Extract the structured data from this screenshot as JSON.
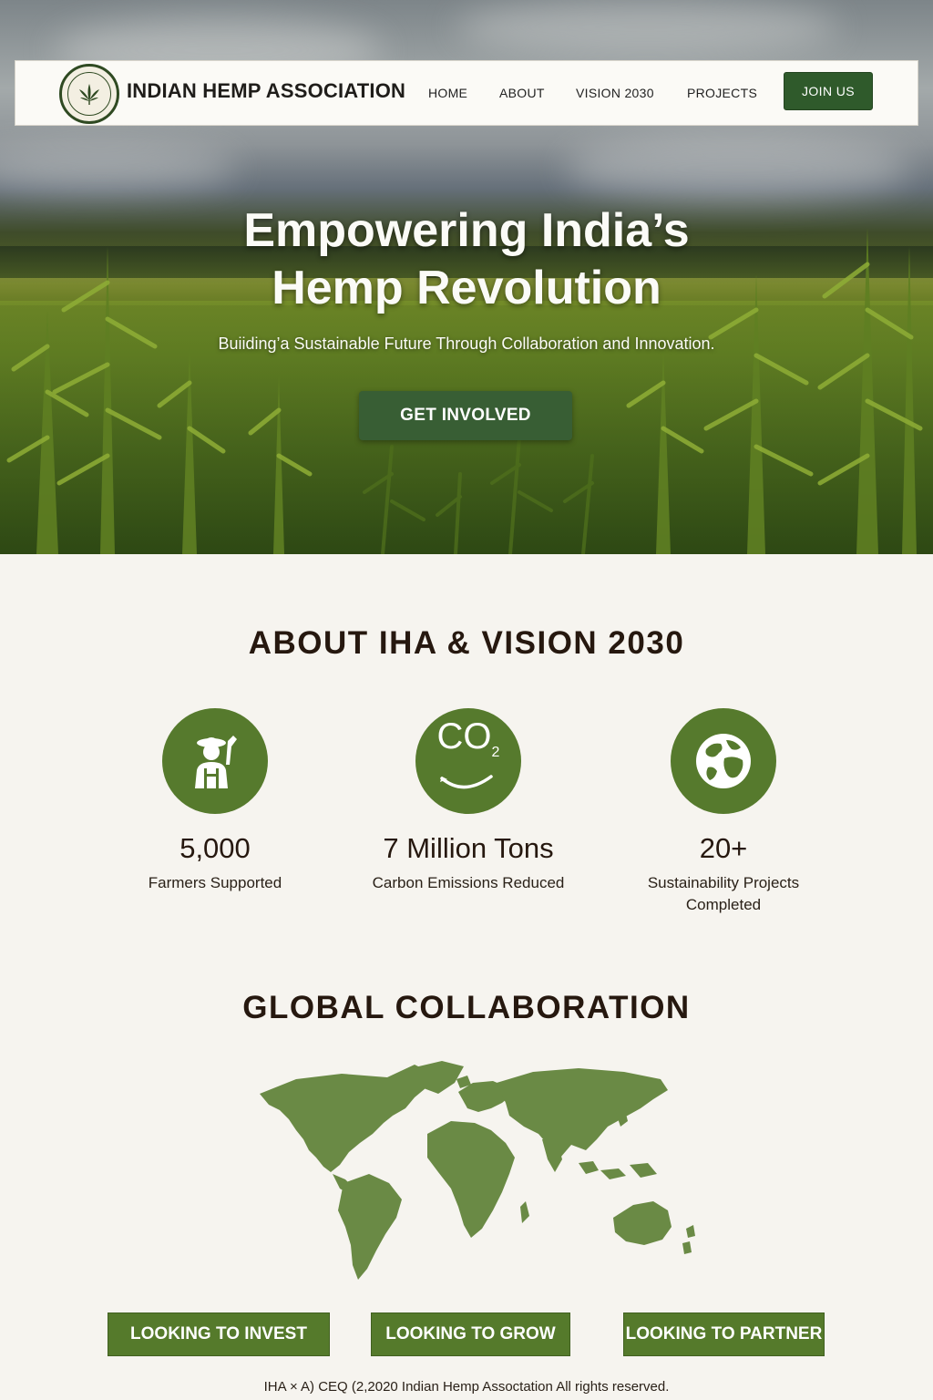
{
  "brand": {
    "name": "INDIAN HEMP ASSOCIATION",
    "logo_icon": "hemp-leaf-seal-icon",
    "accent_color": "#2f5a2b"
  },
  "nav": {
    "items": [
      {
        "label": "HOME"
      },
      {
        "label": "ABOUT"
      },
      {
        "label": "VISION 2030"
      },
      {
        "label": "PROJECTS"
      }
    ],
    "join_label": "JOIN US"
  },
  "hero": {
    "title_line1": "Empowering India’s",
    "title_line2": "Hemp Revolution",
    "subtitle": "Buiiding’a Sustainable Future Through Collaboration and Innovation.",
    "cta_label": "GET INVOLVED"
  },
  "about": {
    "title": "ABOUT IHA & VISION 2030",
    "stats": [
      {
        "icon": "farmer-icon",
        "value": "5,000",
        "label": "Farmers Supported"
      },
      {
        "icon": "co2-icon",
        "icon_text": "CO",
        "icon_sub": "2",
        "value": "7 Million Tons",
        "label": "Carbon Emissions Reduced"
      },
      {
        "icon": "globe-icon",
        "value": "20+",
        "label": "Sustainability Projects Completed"
      }
    ],
    "circle_color": "#567a2d"
  },
  "collaboration": {
    "title": "GLOBAL COLLABORATION",
    "map_icon": "world-map-icon",
    "map_color": "#6a8a45"
  },
  "cta_buttons": [
    {
      "label": "LOOKING TO INVEST"
    },
    {
      "label": "LOOKING TO GROW"
    },
    {
      "label": "LOOKING TO PARTNER"
    }
  ],
  "footer": {
    "text": "IHA  ×  A) CEQ  (2,2020 Indian Hemp Assoctation All rights reserved."
  }
}
